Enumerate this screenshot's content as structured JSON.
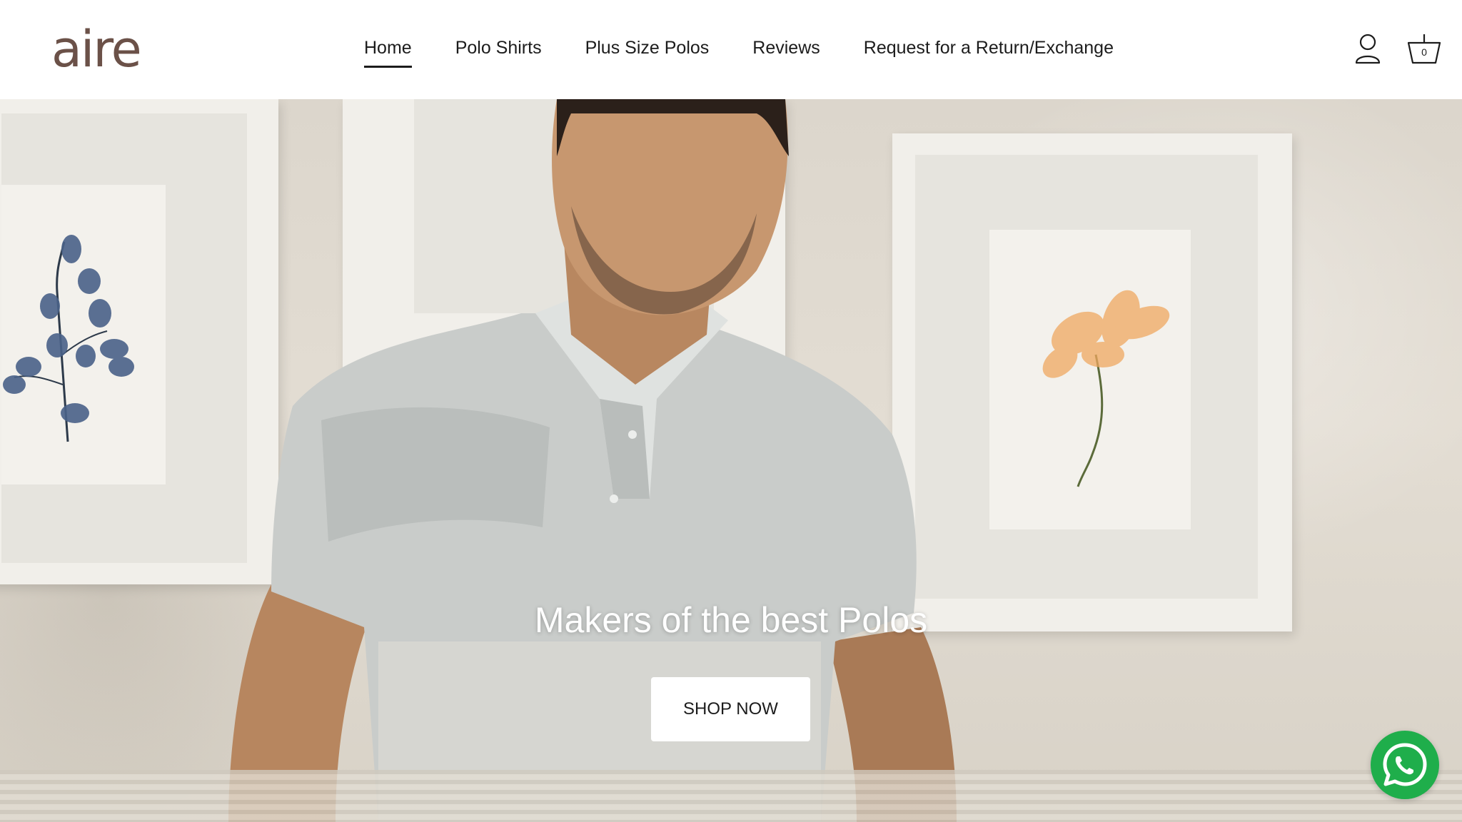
{
  "brand": {
    "logo_text": "aire",
    "logo_color": "#6b5148"
  },
  "nav": {
    "items": [
      {
        "label": "Home",
        "active": true
      },
      {
        "label": "Polo Shirts",
        "active": false
      },
      {
        "label": "Plus Size Polos",
        "active": false
      },
      {
        "label": "Reviews",
        "active": false
      },
      {
        "label": "Request for a Return/Exchange",
        "active": false
      }
    ]
  },
  "header_icons": {
    "account_icon": "user-icon",
    "cart_icon": "basket-icon",
    "cart_count": "0"
  },
  "hero": {
    "title": "Makers of the best Polos",
    "cta_label": "SHOP NOW"
  },
  "floating": {
    "whatsapp_icon": "whatsapp-icon",
    "whatsapp_color": "#1fae4b"
  }
}
